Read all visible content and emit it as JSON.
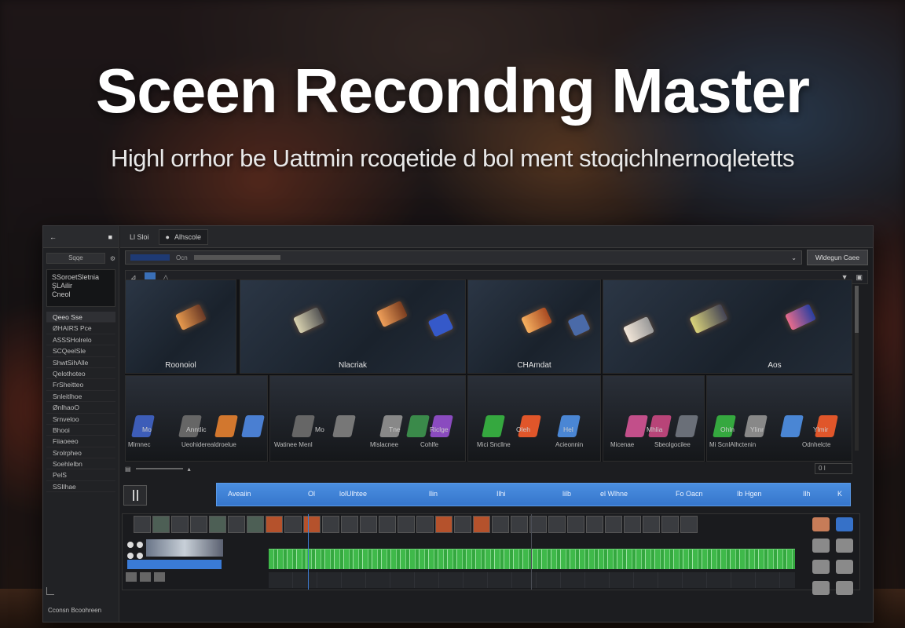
{
  "headline": "Sceen Recondng Master",
  "subhead": "Highl orrhor be Uattmin rcoqetide d  bol  ment stoqichlnernoqletetts",
  "colors": {
    "accent_blue": "#3676cc",
    "waveform_green": "#3fb94a",
    "panel_dark": "#1c1d20"
  },
  "sidebar": {
    "search": "Sqqe",
    "card_lines": [
      "SSoroetSletnia",
      "ŞLAilir",
      "Cneol"
    ],
    "items": [
      {
        "label": "Qeeo Sse"
      },
      {
        "label": "ØHAIRS Pce"
      },
      {
        "label": "ASSSHolrelo"
      },
      {
        "label": "SCQeelSle"
      },
      {
        "label": "ShwtSihAlle"
      },
      {
        "label": "Qelothoteo"
      },
      {
        "label": "FrSheitteo"
      },
      {
        "label": "Snleitlhoe"
      },
      {
        "label": "ØnlhaoO"
      },
      {
        "label": "Srnveloo"
      },
      {
        "label": "Bhooi"
      },
      {
        "label": "Fiiaoeeo"
      },
      {
        "label": "Srolrpheo"
      },
      {
        "label": "Soehlelbn"
      },
      {
        "label": "PelS"
      },
      {
        "label": "SSIlhae"
      }
    ],
    "bottom_label": "Cconsn Bcoohreen"
  },
  "tabs": [
    {
      "label": "Ll Sloi",
      "icon": "home-icon"
    },
    {
      "label": "Alhscole",
      "icon": "record-icon"
    }
  ],
  "address": {
    "text": "Ocn",
    "button_label": "Wldegun Caee"
  },
  "grid": {
    "top_tiles": [
      {
        "caption": "Roonoiol"
      },
      {
        "caption": "Nlacriak"
      },
      {
        "caption": "CHAmdat"
      },
      {
        "caption": "Aos"
      }
    ],
    "bottom_labels": [
      {
        "top": "Mo",
        "bottom": "Mlrnnec"
      },
      {
        "top": "Anntlic",
        "bottom": "Ueohiderealdroelue"
      },
      {
        "top": "Mo",
        "bottom": "Watinee Menl"
      },
      {
        "top": "Tne",
        "bottom": "Mlslacnee"
      },
      {
        "top": "Riclge",
        "bottom": "Cohlfe"
      },
      {
        "top": "Oleh",
        "bottom": "Mici Sncllne"
      },
      {
        "top": "Hel",
        "bottom": "Acieonnin"
      },
      {
        "top": "Mhlia",
        "bottom": "Micenae"
      },
      {
        "top": "Ohln",
        "bottom": "Sbeolgocilee"
      },
      {
        "top": "Ylinr",
        "bottom": "Mi ScnlAlhctenin"
      },
      {
        "top": "Ylmir",
        "bottom": "Odnhelcte"
      }
    ]
  },
  "status": {
    "right": "0 I"
  },
  "bluebar": {
    "segments": [
      "Aveaiin",
      "Ol",
      "lolUlhtee",
      "llin",
      "Ilhi",
      "lilb",
      "el Wlhne",
      "Fo Oacn",
      "Ib Hgen",
      "Ilh",
      "K"
    ]
  }
}
